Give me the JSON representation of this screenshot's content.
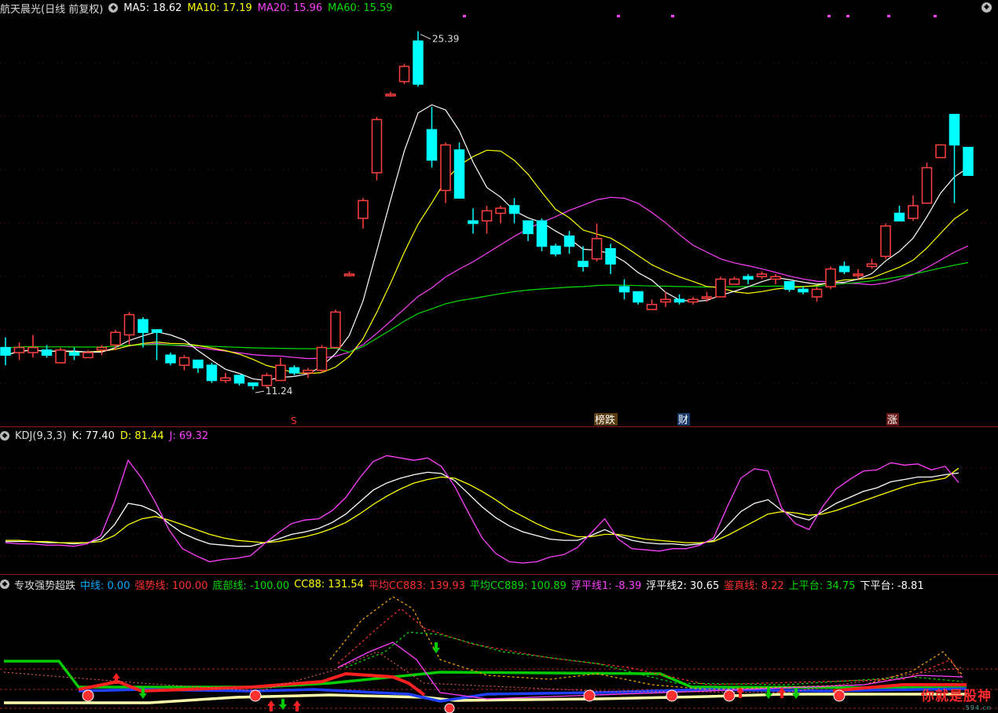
{
  "main_legend": {
    "title": "航天晨光(日线 前复权)",
    "ma5": "MA5: 18.62",
    "ma10": "MA10: 17.19",
    "ma20": "MA20: 15.96",
    "ma60": "MA60: 15.59"
  },
  "kdj_legend": {
    "title": "KDJ(9,3,3)",
    "k": "K: 77.40",
    "d": "D: 81.44",
    "j": "J: 69.32"
  },
  "ind_legend": {
    "title": "专攻强势超跌",
    "items": [
      {
        "text": "中线: 0.00",
        "color": "#00aaff"
      },
      {
        "text": "强势线: 100.00",
        "color": "#ff3030"
      },
      {
        "text": "底部线: -100.00",
        "color": "#00dd00"
      },
      {
        "text": "CC88: 131.54",
        "color": "#ffff00"
      },
      {
        "text": "平均CC883: 139.93",
        "color": "#ff3030"
      },
      {
        "text": "平均CC889: 100.89",
        "color": "#00dd00"
      },
      {
        "text": "浮平线1: -8.39",
        "color": "#ff40ff"
      },
      {
        "text": "浮平线2: 30.65",
        "color": "#ffffff"
      },
      {
        "text": "鉴真线: 8.22",
        "color": "#ff3030"
      },
      {
        "text": "上平台: 34.75",
        "color": "#00dd00"
      },
      {
        "text": "下平台: -8.81",
        "color": "#ffffff"
      }
    ]
  },
  "annotations": {
    "high": "25.39",
    "low": "11.24",
    "tag_s": "S",
    "tag_bang": "榜跌",
    "tag_cai": "财",
    "tag_zhang": "涨"
  },
  "watermark": {
    "text": "你就是股神",
    "sub": ".594.cn"
  },
  "colors": {
    "up": "#ff4040",
    "down": "#00ffff",
    "ma5": "#ffffff",
    "ma10": "#ffff00",
    "ma20": "#ff40ff",
    "ma60": "#00dd00",
    "k": "#ffffff",
    "d": "#ffff00",
    "j": "#ff40ff"
  },
  "chart_data": [
    {
      "type": "candlestick",
      "title": "航天晨光(日线 前复权)",
      "ylim": [
        10.5,
        26
      ],
      "candles": [
        [
          12.9,
          12.6,
          13.3,
          12.2
        ],
        [
          12.7,
          12.9,
          13.1,
          12.4
        ],
        [
          12.7,
          12.9,
          13.4,
          12.5
        ],
        [
          12.8,
          12.6,
          13.0,
          12.5
        ],
        [
          12.3,
          12.8,
          12.9,
          12.3
        ],
        [
          12.7,
          12.6,
          12.9,
          12.4
        ],
        [
          12.5,
          12.7,
          12.8,
          12.5
        ],
        [
          12.8,
          12.9,
          13.0,
          12.6
        ],
        [
          13.0,
          13.5,
          13.6,
          12.8
        ],
        [
          13.4,
          14.2,
          14.3,
          13.0
        ],
        [
          14.0,
          13.5,
          14.1,
          12.9
        ],
        [
          13.6,
          13.5,
          13.6,
          12.4
        ],
        [
          12.6,
          12.3,
          12.7,
          12.2
        ],
        [
          12.2,
          12.5,
          12.6,
          12.0
        ],
        [
          12.4,
          12.1,
          12.4,
          11.9
        ],
        [
          12.2,
          11.6,
          12.3,
          11.5
        ],
        [
          11.6,
          11.7,
          11.9,
          11.5
        ],
        [
          11.8,
          11.5,
          11.8,
          11.4
        ],
        [
          11.5,
          11.4,
          11.5,
          11.24
        ],
        [
          11.4,
          11.8,
          11.9,
          11.3
        ],
        [
          11.6,
          12.2,
          12.5,
          11.6
        ],
        [
          12.1,
          11.9,
          12.2,
          11.8
        ],
        [
          11.9,
          12.0,
          12.1,
          11.7
        ],
        [
          12.0,
          12.9,
          13.0,
          11.9
        ],
        [
          12.9,
          14.3,
          14.4,
          12.9
        ],
        [
          15.8,
          15.8,
          15.9,
          15.7
        ],
        [
          18.0,
          18.7,
          18.8,
          17.6
        ],
        [
          19.8,
          21.9,
          22.0,
          19.5
        ],
        [
          22.9,
          22.9,
          23.0,
          22.8
        ],
        [
          23.4,
          24.0,
          24.1,
          23.3
        ],
        [
          25.0,
          23.3,
          25.39,
          23.2
        ],
        [
          21.5,
          20.3,
          22.4,
          20.0
        ],
        [
          19.1,
          20.9,
          21.0,
          18.6
        ],
        [
          20.7,
          18.8,
          21.0,
          18.8
        ],
        [
          17.9,
          17.8,
          18.4,
          17.4
        ],
        [
          17.9,
          18.3,
          18.5,
          17.4
        ],
        [
          18.2,
          18.4,
          18.5,
          17.8
        ],
        [
          18.5,
          18.2,
          18.8,
          17.8
        ],
        [
          17.9,
          17.4,
          17.9,
          17.1
        ],
        [
          17.9,
          16.9,
          18.0,
          16.7
        ],
        [
          16.9,
          16.6,
          17.0,
          16.5
        ],
        [
          17.3,
          16.9,
          17.5,
          16.6
        ],
        [
          16.3,
          16.1,
          16.9,
          15.9
        ],
        [
          16.4,
          17.2,
          17.8,
          16.3
        ],
        [
          16.8,
          16.2,
          17.0,
          15.8
        ],
        [
          15.3,
          15.1,
          15.6,
          14.8
        ],
        [
          15.1,
          14.7,
          15.1,
          14.6
        ],
        [
          14.4,
          14.6,
          14.8,
          14.4
        ],
        [
          14.7,
          14.8,
          15.1,
          14.5
        ],
        [
          14.8,
          14.7,
          15.0,
          14.6
        ],
        [
          14.7,
          14.8,
          14.9,
          14.6
        ],
        [
          14.9,
          14.9,
          15.1,
          14.7
        ],
        [
          14.9,
          15.6,
          15.7,
          14.9
        ],
        [
          15.4,
          15.6,
          15.7,
          15.4
        ],
        [
          15.7,
          15.6,
          15.8,
          15.4
        ],
        [
          15.7,
          15.8,
          15.9,
          15.6
        ],
        [
          15.6,
          15.7,
          15.8,
          15.4
        ],
        [
          15.5,
          15.2,
          15.5,
          15.1
        ],
        [
          15.2,
          15.1,
          15.3,
          15.0
        ],
        [
          14.9,
          15.2,
          15.3,
          14.7
        ],
        [
          15.3,
          16.0,
          16.1,
          15.2
        ],
        [
          16.1,
          15.9,
          16.3,
          15.8
        ],
        [
          15.8,
          15.8,
          16.0,
          15.6
        ],
        [
          16.1,
          16.2,
          16.4,
          16.0
        ],
        [
          16.5,
          17.7,
          17.8,
          16.4
        ],
        [
          18.2,
          17.9,
          18.5,
          17.9
        ],
        [
          18.0,
          18.5,
          18.9,
          17.9
        ],
        [
          18.6,
          20.0,
          20.2,
          18.6
        ],
        [
          20.4,
          20.9,
          20.9,
          20.5
        ],
        [
          22.1,
          20.9,
          22.1,
          18.6
        ],
        [
          20.8,
          19.7,
          20.8,
          19.7
        ]
      ],
      "high_label": 25.39,
      "low_label": 11.24
    },
    {
      "type": "line",
      "title": "KDJ(9,3,3)",
      "series": [
        {
          "name": "K",
          "values": [
            20,
            20,
            20,
            19,
            19,
            18,
            19,
            22,
            34,
            52,
            50,
            45,
            35,
            27,
            22,
            18,
            17,
            16,
            16,
            19,
            22,
            26,
            28,
            31,
            36,
            43,
            53,
            63,
            69,
            73,
            76,
            78,
            77,
            71,
            60,
            49,
            40,
            33,
            28,
            25,
            22,
            21,
            21,
            25,
            30,
            25,
            21,
            19,
            18,
            18,
            17,
            18,
            21,
            33,
            45,
            52,
            55,
            46,
            41,
            38,
            45,
            52,
            57,
            62,
            65,
            70,
            72,
            74,
            74,
            76,
            77.4
          ]
        },
        {
          "name": "D",
          "values": [
            21,
            21,
            20,
            20,
            19,
            19,
            19,
            20,
            25,
            34,
            39,
            41,
            38,
            34,
            30,
            26,
            23,
            21,
            20,
            19,
            20,
            22,
            24,
            27,
            31,
            36,
            43,
            51,
            58,
            64,
            69,
            72,
            74,
            73,
            68,
            62,
            55,
            47,
            41,
            35,
            30,
            27,
            24,
            24,
            26,
            26,
            24,
            22,
            21,
            20,
            19,
            19,
            20,
            25,
            31,
            37,
            43,
            45,
            44,
            42,
            43,
            46,
            50,
            54,
            58,
            62,
            66,
            69,
            71,
            73,
            81.44
          ]
        },
        {
          "name": "J",
          "values": [
            19,
            18,
            18,
            17,
            17,
            16,
            18,
            25,
            53,
            88,
            73,
            53,
            30,
            14,
            8,
            3,
            5,
            6,
            8,
            18,
            27,
            35,
            38,
            39,
            46,
            57,
            73,
            87,
            92,
            90,
            88,
            90,
            83,
            66,
            44,
            23,
            10,
            3,
            2,
            3,
            7,
            9,
            15,
            27,
            39,
            22,
            14,
            13,
            12,
            14,
            14,
            17,
            23,
            49,
            73,
            81,
            79,
            48,
            35,
            30,
            49,
            64,
            72,
            79,
            80,
            86,
            84,
            85,
            80,
            83,
            69.32
          ]
        }
      ]
    }
  ]
}
